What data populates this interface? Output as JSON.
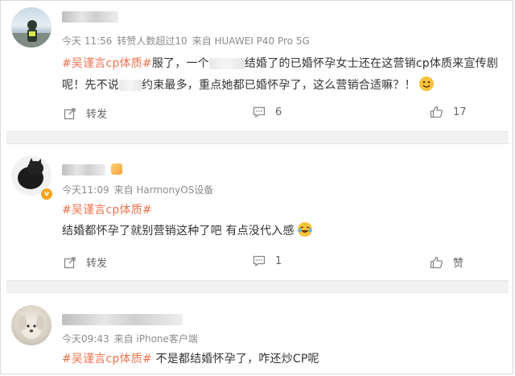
{
  "comments": [
    {
      "time": "今天 11:56",
      "repost_count_text": "转赞人数超过10",
      "source": "来自 HUAWEI P40 Pro 5G",
      "line1_tag": "#吴谨言cp体质#",
      "line1_a": "服了，一个",
      "line1_b": "结婚了的已婚怀孕女士还在这营销cp体质来宣传剧",
      "line2_a": "呢！先不说",
      "line2_b": "约束最多，重点她都已婚怀孕了，这么营销合适嘛？！",
      "repost_label": "转发",
      "comment_count": "6",
      "like_count": "17"
    },
    {
      "time": "今天11:09",
      "source": "来自 HarmonyOS设备",
      "tag": "#吴谨言cp体质#",
      "text": "结婚都怀孕了就别营销这种了吧 有点没代入感",
      "repost_label": "转发",
      "comment_count": "1",
      "like_label": "赞"
    },
    {
      "time": "今天09:43",
      "source": "来自 iPhone客户端",
      "tag": "#吴谨言cp体质#",
      "text": " 不是都结婚怀孕了，咋还炒CP呢"
    }
  ],
  "colors": {
    "topic": "#eb7350",
    "meta": "#8c8c8c",
    "badge": "#f5a623"
  }
}
